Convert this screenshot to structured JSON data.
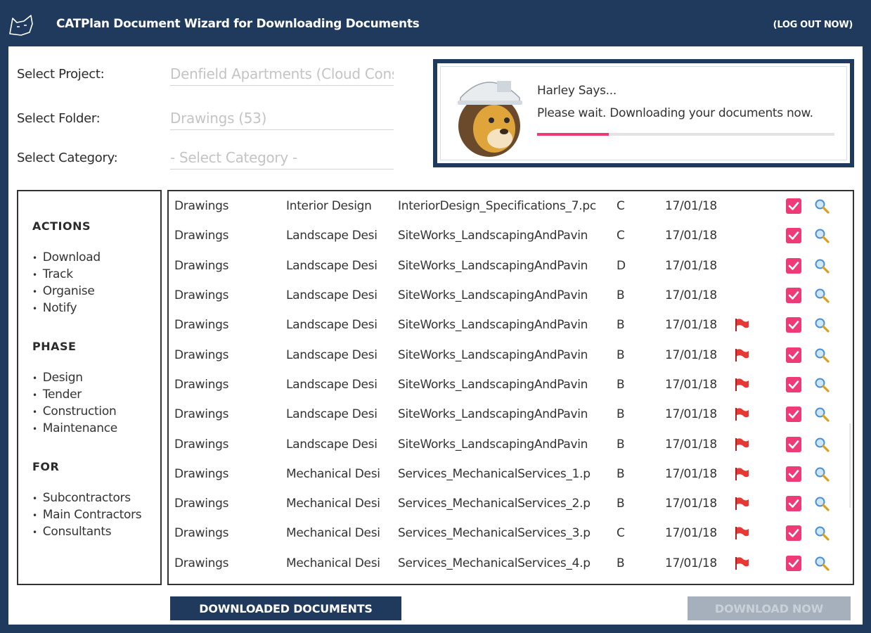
{
  "header": {
    "title": "CATPlan Document Wizard for Downloading Documents",
    "logout_label": "(LOG OUT NOW)"
  },
  "form": {
    "project_label": "Select Project:",
    "project_value": "Denfield Apartments (Cloud Cons",
    "folder_label": "Select Folder:",
    "folder_value": "Drawings (53)",
    "category_label": "Select Category:",
    "category_value": "- Select Category -"
  },
  "harley": {
    "title": "Harley Says...",
    "message": "Please wait. Downloading your documents now.",
    "progress_fraction": 0.24
  },
  "sidebar": {
    "actions_title": "ACTIONS",
    "actions": [
      "Download",
      "Track",
      "Organise",
      "Notify"
    ],
    "phase_title": "PHASE",
    "phase": [
      "Design",
      "Tender",
      "Construction",
      "Maintenance"
    ],
    "for_title": "FOR",
    "for_items": [
      "Subcontractors",
      "Main Contractors",
      "Consultants"
    ]
  },
  "colors": {
    "navy": "#1f3a5c",
    "accent_pink": "#ee3a76",
    "flag_red": "#e53935",
    "magnifier_blue": "#4a90d9"
  },
  "documents": [
    {
      "folder": "Drawings",
      "category": "Interior Design",
      "file": "InteriorDesign_Specifications_7.pc",
      "rev": "C",
      "date": "17/01/18",
      "flag": false,
      "checked": true
    },
    {
      "folder": "Drawings",
      "category": "Landscape Desi",
      "file": "SiteWorks_LandscapingAndPavin",
      "rev": "C",
      "date": "17/01/18",
      "flag": false,
      "checked": true
    },
    {
      "folder": "Drawings",
      "category": "Landscape Desi",
      "file": "SiteWorks_LandscapingAndPavin",
      "rev": "D",
      "date": "17/01/18",
      "flag": false,
      "checked": true
    },
    {
      "folder": "Drawings",
      "category": "Landscape Desi",
      "file": "SiteWorks_LandscapingAndPavin",
      "rev": "B",
      "date": "17/01/18",
      "flag": false,
      "checked": true
    },
    {
      "folder": "Drawings",
      "category": "Landscape Desi",
      "file": "SiteWorks_LandscapingAndPavin",
      "rev": "B",
      "date": "17/01/18",
      "flag": true,
      "checked": true
    },
    {
      "folder": "Drawings",
      "category": "Landscape Desi",
      "file": "SiteWorks_LandscapingAndPavin",
      "rev": "B",
      "date": "17/01/18",
      "flag": true,
      "checked": true
    },
    {
      "folder": "Drawings",
      "category": "Landscape Desi",
      "file": "SiteWorks_LandscapingAndPavin",
      "rev": "B",
      "date": "17/01/18",
      "flag": true,
      "checked": true
    },
    {
      "folder": "Drawings",
      "category": "Landscape Desi",
      "file": "SiteWorks_LandscapingAndPavin",
      "rev": "B",
      "date": "17/01/18",
      "flag": true,
      "checked": true
    },
    {
      "folder": "Drawings",
      "category": "Landscape Desi",
      "file": "SiteWorks_LandscapingAndPavin",
      "rev": "B",
      "date": "17/01/18",
      "flag": true,
      "checked": true
    },
    {
      "folder": "Drawings",
      "category": "Mechanical Desi",
      "file": "Services_MechanicalServices_1.p",
      "rev": "B",
      "date": "17/01/18",
      "flag": true,
      "checked": true
    },
    {
      "folder": "Drawings",
      "category": "Mechanical Desi",
      "file": "Services_MechanicalServices_2.p",
      "rev": "B",
      "date": "17/01/18",
      "flag": true,
      "checked": true
    },
    {
      "folder": "Drawings",
      "category": "Mechanical Desi",
      "file": "Services_MechanicalServices_3.p",
      "rev": "C",
      "date": "17/01/18",
      "flag": true,
      "checked": true
    },
    {
      "folder": "Drawings",
      "category": "Mechanical Desi",
      "file": "Services_MechanicalServices_4.p",
      "rev": "B",
      "date": "17/01/18",
      "flag": true,
      "checked": true
    }
  ],
  "buttons": {
    "downloaded_label": "DOWNLOADED DOCUMENTS",
    "download_now_label": "DOWNLOAD NOW"
  }
}
